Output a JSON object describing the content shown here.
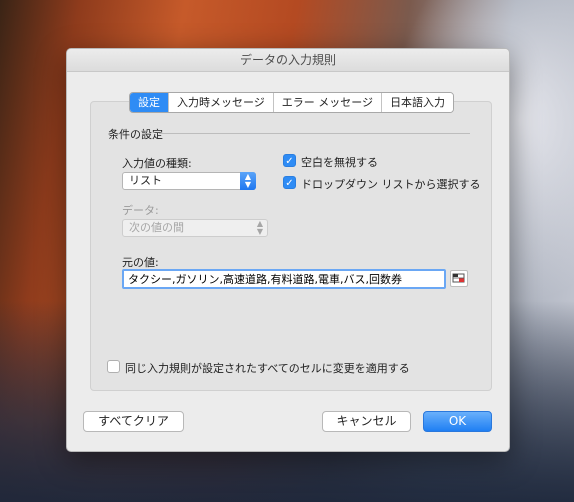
{
  "dialog": {
    "title": "データの入力規則"
  },
  "tabs": [
    {
      "label": "設定",
      "active": true
    },
    {
      "label": "入力時メッセージ",
      "active": false
    },
    {
      "label": "エラー メッセージ",
      "active": false
    },
    {
      "label": "日本語入力",
      "active": false
    }
  ],
  "criteria": {
    "section_title": "条件の設定",
    "allow_label": "入力値の種類:",
    "allow_value": "リスト",
    "data_label": "データ:",
    "data_value": "次の値の間",
    "ignore_blank_label": "空白を無視する",
    "ignore_blank_checked": true,
    "dropdown_label": "ドロップダウン リストから選択する",
    "dropdown_checked": true,
    "source_label": "元の値:",
    "source_value": "タクシー,ガソリン,高速道路,有料道路,電車,バス,回数券"
  },
  "apply_all": {
    "label": "同じ入力規則が設定されたすべてのセルに変更を適用する",
    "checked": false
  },
  "buttons": {
    "clear_all": "すべてクリア",
    "cancel": "キャンセル",
    "ok": "OK"
  },
  "colors": {
    "accent": "#2f8cf5"
  }
}
